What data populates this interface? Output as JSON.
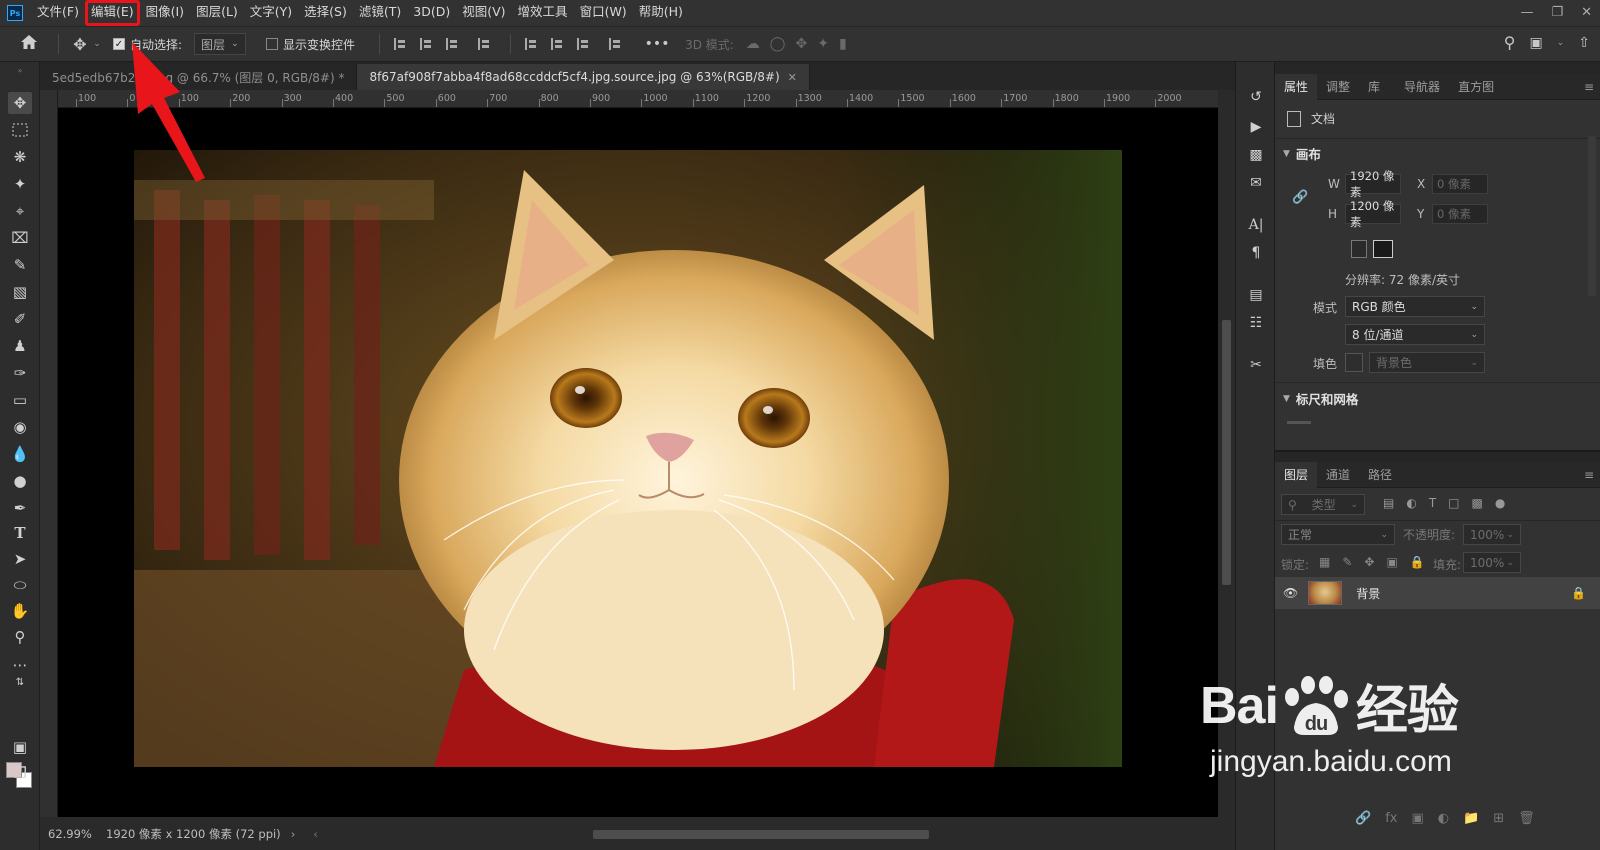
{
  "menu": {
    "logo": "Ps",
    "items": [
      "文件(F)",
      "编辑(E)",
      "图像(I)",
      "图层(L)",
      "文字(Y)",
      "选择(S)",
      "滤镜(T)",
      "3D(D)",
      "视图(V)",
      "增效工具",
      "窗口(W)",
      "帮助(H)"
    ],
    "highlighted_index": 1
  },
  "options": {
    "auto_select_label": "自动选择:",
    "auto_select_value": "图层",
    "show_transform_label": "显示变换控件",
    "mode3d_label": "3D 模式:"
  },
  "tabs": [
    {
      "label": "5ed5edb67b274.jpg @ 66.7% (图层 0, RGB/8#) *",
      "active": false
    },
    {
      "label": "8f67af908f7abba4f8ad68ccddcf5cf4.jpg.source.jpg @ 63%(RGB/8#)",
      "active": true
    }
  ],
  "ruler": {
    "labels": [
      "100",
      "0",
      "100",
      "200",
      "300",
      "400",
      "500",
      "600",
      "700",
      "800",
      "900",
      "1000",
      "1100",
      "1200",
      "1300",
      "1400",
      "1500",
      "1600",
      "1700",
      "1800",
      "1900",
      "2000"
    ]
  },
  "status": {
    "zoom": "62.99%",
    "doc_info": "1920 像素 x 1200 像素 (72 ppi)"
  },
  "properties": {
    "tabs": [
      "属性",
      "调整",
      "库",
      "导航器",
      "直方图"
    ],
    "doc_label": "文档",
    "canvas_title": "画布",
    "w_label": "W",
    "w_value": "1920 像素",
    "h_label": "H",
    "h_value": "1200 像素",
    "x_label": "X",
    "x_placeholder": "0 像素",
    "y_label": "Y",
    "y_placeholder": "0 像素",
    "resolution": "分辨率: 72 像素/英寸",
    "mode_label": "模式",
    "mode_value": "RGB 颜色",
    "depth_value": "8 位/通道",
    "fill_label": "填色",
    "fill_value": "背景色",
    "rulers_grid_title": "标尺和网格"
  },
  "layers": {
    "tabs": [
      "图层",
      "通道",
      "路径"
    ],
    "filter_label": "类型",
    "blend_mode": "正常",
    "opacity_label": "不透明度:",
    "opacity_value": "100%",
    "lock_label": "锁定:",
    "fill_label": "填充:",
    "fill_value": "100%",
    "layer_name": "背景"
  },
  "watermark": {
    "brand": "Bai",
    "brand_tail": "经验",
    "url": "jingyan.baidu.com"
  },
  "colors": {
    "highlight": "#e8161b",
    "foreground": "#dcc7c7",
    "background": "#ffffff"
  }
}
